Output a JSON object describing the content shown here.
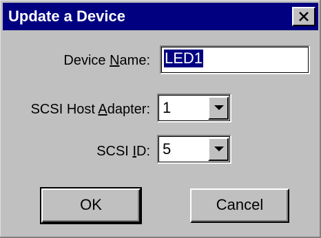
{
  "dialog": {
    "title": "Update a Device"
  },
  "fields": {
    "device_name": {
      "label_pre": "Device ",
      "label_mn": "N",
      "label_post": "ame:",
      "value": "LED1"
    },
    "scsi_host_adapter": {
      "label_pre": "SCSI Host ",
      "label_mn": "A",
      "label_post": "dapter:",
      "value": "1"
    },
    "scsi_id": {
      "label_pre": "SCSI ",
      "label_mn": "I",
      "label_post": "D:",
      "value": "5"
    }
  },
  "buttons": {
    "ok": "OK",
    "cancel": "Cancel"
  },
  "icons": {
    "close": "close-icon",
    "dropdown": "chevron-down-icon"
  },
  "colors": {
    "titlebar": "#000080",
    "face": "#c0c0c0",
    "selection": "#000080"
  }
}
